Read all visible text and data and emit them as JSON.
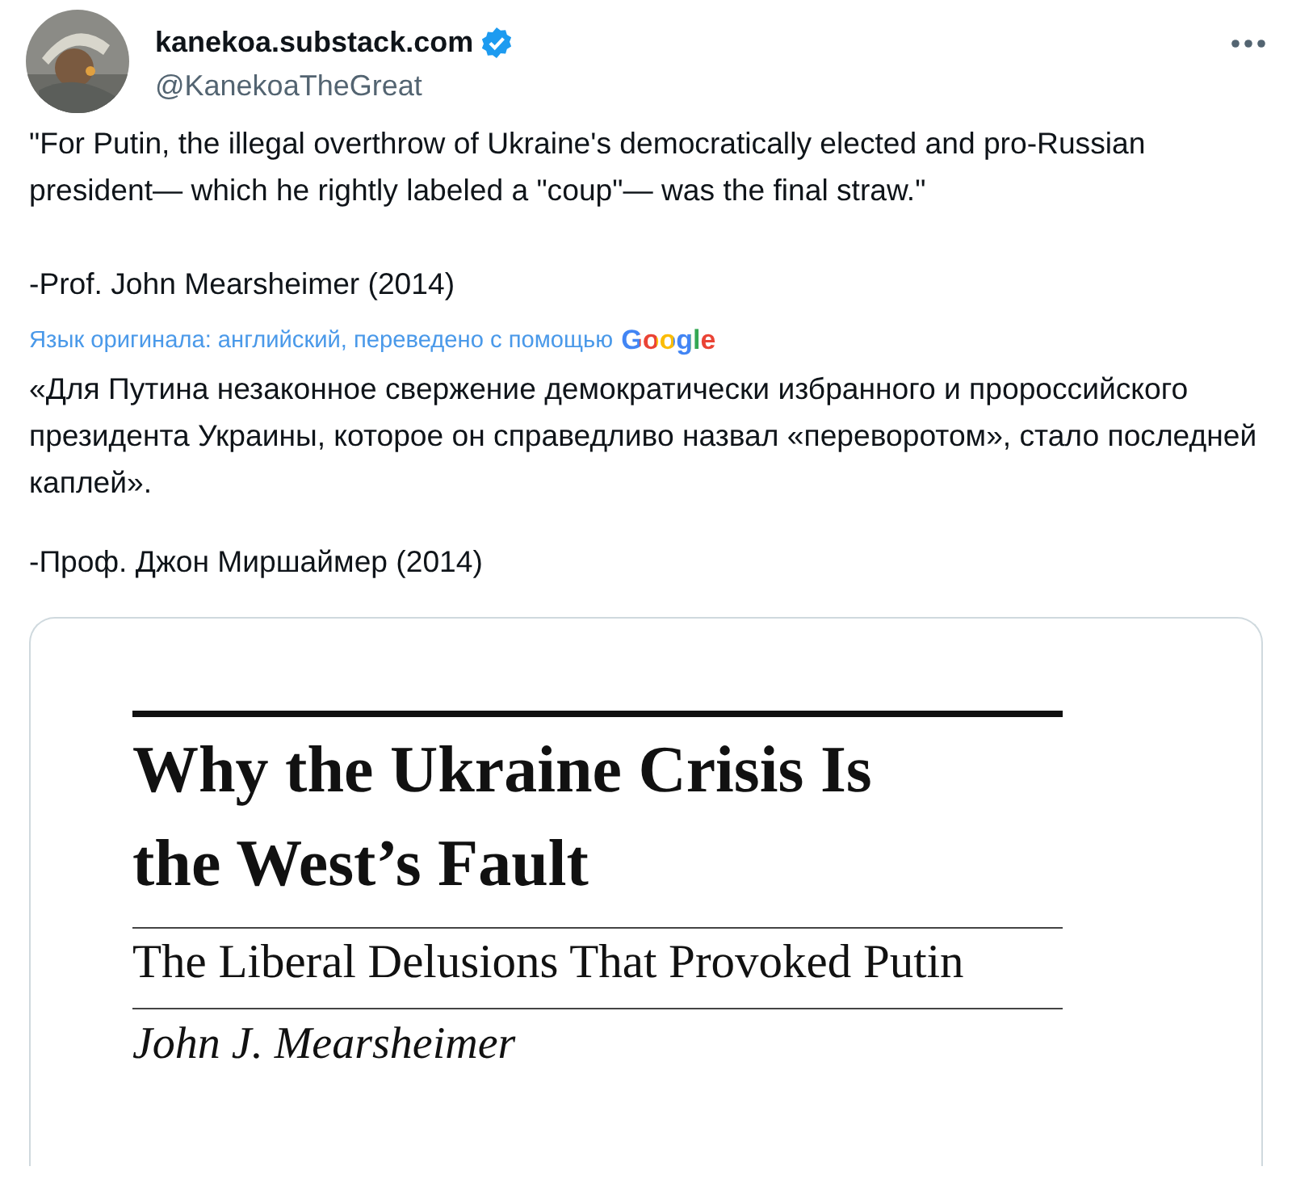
{
  "author": {
    "name": "kanekoa.substack.com",
    "verified": true,
    "handle": "@KanekoaTheGreat"
  },
  "text": [
    "\"For Putin, the illegal overthrow of Ukraine's democratically elected and pro-Russian president— which he rightly labeled a \"coup\"— was the final straw.\"",
    "-Prof. John Mearsheimer (2014)"
  ],
  "translation_note": {
    "text": "Язык оригинала: английский, переведено с помощью",
    "provider": "Google"
  },
  "translated_text": [
    "«Для Путина незаконное свержение демократически избранного и пророссийского президента Украины, которое он справедливо назвал «переворотом», стало последней каплей».",
    "-Проф. Джон Миршаймер (2014)"
  ],
  "media": {
    "kind": "document",
    "title": [
      "Why the Ukraine Crisis Is",
      "the West’s Fault"
    ],
    "subtitle": "The Liberal Delusions That Provoked Putin",
    "byline": "John J. Mearsheimer"
  }
}
